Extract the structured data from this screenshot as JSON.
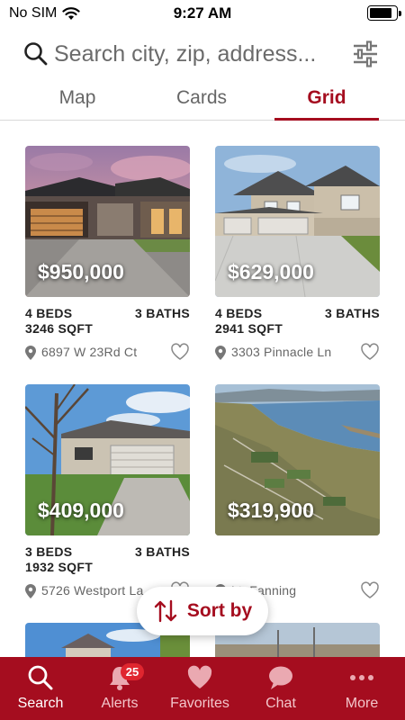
{
  "status_bar": {
    "carrier": "No SIM",
    "time": "9:27 AM",
    "battery_level": 0.85
  },
  "search": {
    "placeholder": "Search city, zip, address..."
  },
  "tabs": [
    {
      "label": "Map",
      "active": false
    },
    {
      "label": "Cards",
      "active": false
    },
    {
      "label": "Grid",
      "active": true
    }
  ],
  "listings": [
    {
      "price": "$950,000",
      "beds": "4 BEDS",
      "baths": "3 BATHS",
      "sqft": "3246 SQFT",
      "address": "6897 W 23Rd Ct",
      "photo": "modern-house-dusk"
    },
    {
      "price": "$629,000",
      "beds": "4 BEDS",
      "baths": "3 BATHS",
      "sqft": "2941 SQFT",
      "address": "3303 Pinnacle Ln",
      "photo": "two-story-house"
    },
    {
      "price": "$409,000",
      "beds": "3 BEDS",
      "baths": "3 BATHS",
      "sqft": "1932 SQFT",
      "address": "5726 Westport La",
      "photo": "house-with-tree"
    },
    {
      "price": "$319,900",
      "beds": "",
      "baths": "",
      "sqft": "",
      "address": "Lt. Fanning",
      "photo": "aerial-river-lots"
    }
  ],
  "sort": {
    "label": "Sort by"
  },
  "bottom_nav": [
    {
      "label": "Search",
      "icon": "search-icon",
      "active": true
    },
    {
      "label": "Alerts",
      "icon": "bell-icon",
      "badge": "25"
    },
    {
      "label": "Favorites",
      "icon": "heart-icon"
    },
    {
      "label": "Chat",
      "icon": "chat-bubble-icon"
    },
    {
      "label": "More",
      "icon": "more-dots-icon"
    }
  ],
  "colors": {
    "accent": "#a50d1f",
    "badge": "#e0262f"
  }
}
